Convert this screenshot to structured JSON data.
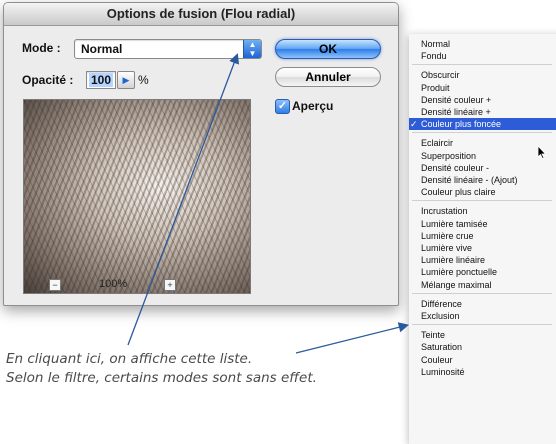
{
  "dialog": {
    "title": "Options de fusion (Flou radial)",
    "mode_label": "Mode :",
    "mode_value": "Normal",
    "opacity_label": "Opacité :",
    "opacity_value": "100",
    "opacity_unit": "%",
    "ok_label": "OK",
    "cancel_label": "Annuler",
    "preview_label": "Aperçu",
    "preview_checked": true,
    "zoom_value": "100%"
  },
  "menu": {
    "groups": [
      [
        "Normal",
        "Fondu"
      ],
      [
        "Obscurcir",
        "Produit",
        "Densité couleur +",
        "Densité linéaire +",
        "Couleur plus foncée"
      ],
      [
        "Eclaircir",
        "Superposition",
        "Densité couleur -",
        "Densité linéaire - (Ajout)",
        "Couleur plus claire"
      ],
      [
        "Incrustation",
        "Lumière tamisée",
        "Lumière crue",
        "Lumière vive",
        "Lumière linéaire",
        "Lumière ponctuelle",
        "Mélange maximal"
      ],
      [
        "Différence",
        "Exclusion"
      ],
      [
        "Teinte",
        "Saturation",
        "Couleur",
        "Luminosité"
      ]
    ],
    "selected": "Couleur plus foncée",
    "selected_mark": "✓"
  },
  "caption": {
    "line1": "En cliquant ici, on affiche cette liste.",
    "line2": "Selon le filtre, certains modes sont sans effet."
  },
  "colors": {
    "accent": "#2e5bd6",
    "leader": "#2a5a9e"
  }
}
